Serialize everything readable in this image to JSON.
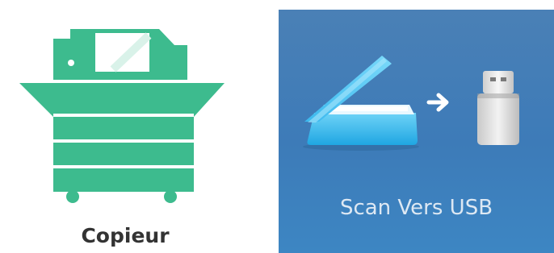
{
  "tiles": {
    "copier": {
      "label": "Copieur",
      "icon": "copier-icon",
      "color": "#3dbb8e"
    },
    "scan_to_usb": {
      "label": "Scan Vers USB",
      "icon": "scanner-icon",
      "secondary_icon": "usb-drive-icon",
      "arrow_icon": "arrow-right-icon",
      "background": "#4a80b6"
    }
  }
}
